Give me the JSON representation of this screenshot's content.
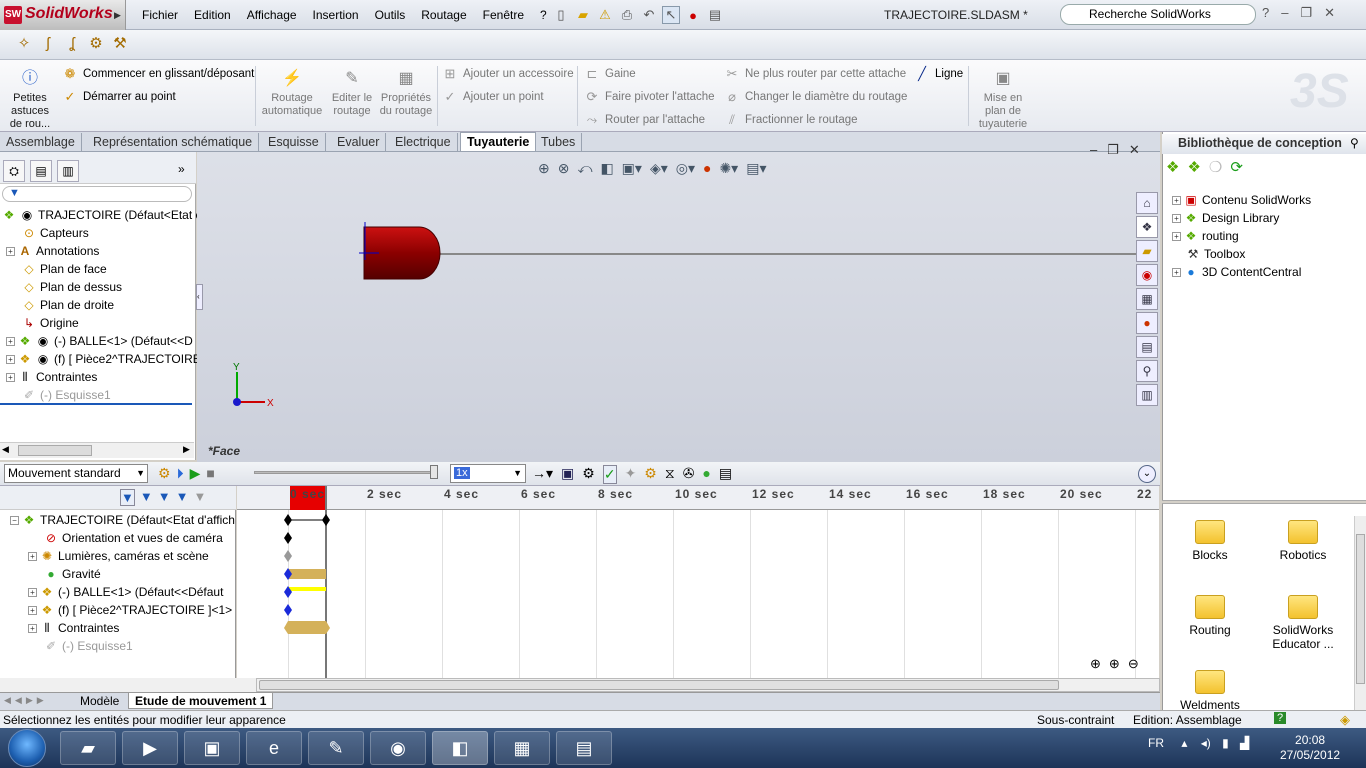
{
  "app": {
    "logo_text": "SolidWorks",
    "logo_badge": "SW",
    "title": "TRAJECTOIRE.SLDASM *"
  },
  "menu": [
    "Fichier",
    "Edition",
    "Affichage",
    "Insertion",
    "Outils",
    "Routage",
    "Fenêtre",
    "?"
  ],
  "search": {
    "placeholder": "Recherche SolidWorks"
  },
  "ribbon": {
    "petites_astuces": "Petites astuces de rou...",
    "commencer": "Commencer en glissant/déposant",
    "demarrer": "Démarrer au point",
    "routage_auto": "Routage automatique",
    "editer_routage": "Editer le routage",
    "proprietes": "Propriétés du routage",
    "ajouter_accessoire": "Ajouter un accessoire",
    "ajouter_point": "Ajouter un point",
    "gaine": "Gaine",
    "faire_pivoter": "Faire pivoter l'attache",
    "router_attache": "Router par l'attache",
    "ne_plus_router": "Ne plus router par cette attache",
    "changer_diametre": "Changer le diamètre du routage",
    "fractionner": "Fractionner le routage",
    "ligne": "Ligne",
    "mise_en_plan": "Mise en plan de tuyauterie"
  },
  "tabs": [
    "Assemblage",
    "Représentation schématique",
    "Esquisse",
    "Evaluer",
    "Electrique",
    "Tuyauterie",
    "Tubes"
  ],
  "active_tab": "Tuyauterie",
  "feature_tree": [
    {
      "label": "TRAJECTOIRE  (Défaut<Etat c",
      "icon": "assembly-icon"
    },
    {
      "label": "Capteurs",
      "icon": "sensor-icon"
    },
    {
      "label": "Annotations",
      "icon": "annotation-icon"
    },
    {
      "label": "Plan de face",
      "icon": "plane-icon"
    },
    {
      "label": "Plan de dessus",
      "icon": "plane-icon"
    },
    {
      "label": "Plan de droite",
      "icon": "plane-icon"
    },
    {
      "label": "Origine",
      "icon": "origin-icon"
    },
    {
      "label": "(-) BALLE<1> (Défaut<<D",
      "icon": "part-icon"
    },
    {
      "label": "(f) [ Pièce2^TRAJECTOIRE",
      "icon": "part-icon"
    },
    {
      "label": "Contraintes",
      "icon": "mates-icon"
    },
    {
      "label": "(-) Esquisse1",
      "icon": "sketch-icon"
    }
  ],
  "viewport": {
    "face_label": "*Face",
    "axis_x": "X",
    "axis_y": "Y"
  },
  "motion": {
    "study_type": "Mouvement standard",
    "speed": "1x",
    "tree": [
      "TRAJECTOIRE  (Défaut<Etat d'affich",
      "Orientation et vues de caméra",
      "Lumières, caméras et scène",
      "Gravité",
      "(-) BALLE<1>  (Défaut<<Défaut",
      "(f) [ Pièce2^TRAJECTOIRE ]<1>",
      "Contraintes",
      "(-) Esquisse1"
    ],
    "ticks": [
      "0 sec",
      "2 sec",
      "4 sec",
      "6 sec",
      "8 sec",
      "10 sec",
      "12 sec",
      "14 sec",
      "16 sec",
      "18 sec",
      "20 sec",
      "22"
    ]
  },
  "bottom_tabs": [
    "Modèle",
    "Etude de mouvement 1"
  ],
  "library": {
    "title": "Bibliothèque de conception",
    "items": [
      "Contenu SolidWorks",
      "Design Library",
      "routing",
      "Toolbox",
      "3D ContentCentral"
    ],
    "folders": [
      "Blocks",
      "Robotics",
      "Routing",
      "SolidWorks Educator ...",
      "Weldments"
    ]
  },
  "status": {
    "message": "Sélectionnez les entités pour modifier leur apparence",
    "constraint": "Sous-contraint",
    "edition": "Edition: Assemblage"
  },
  "taskbar": {
    "lang": "FR",
    "time": "20:08",
    "date": "27/05/2012"
  },
  "colors": {
    "accent_red": "#e60000",
    "ball_red": "#8b0000",
    "gravity_bar": "#d4b15a",
    "highlight_yellow": "#ffff00"
  }
}
